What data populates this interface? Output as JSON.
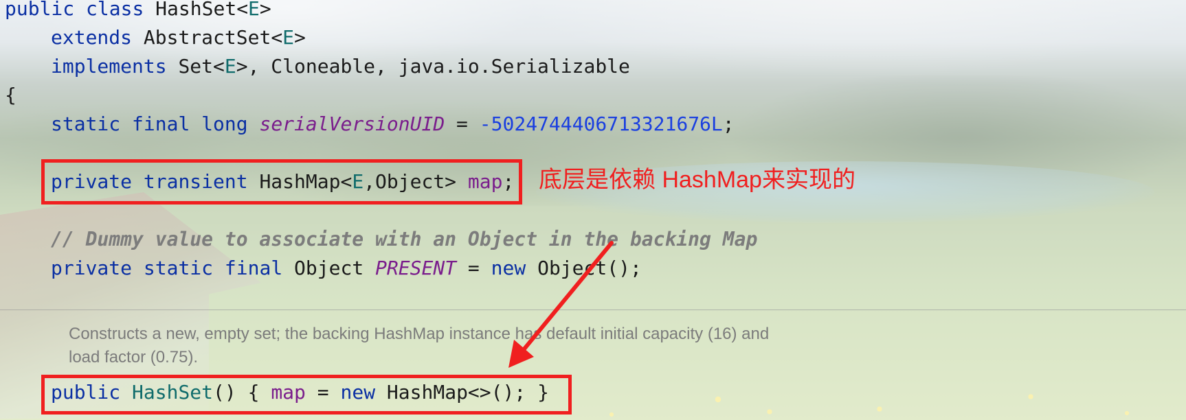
{
  "code": {
    "line1": {
      "kw_public": "public",
      "kw_class": "class",
      "class_name": "HashSet",
      "lt": "<",
      "type_param": "E",
      "gt": ">"
    },
    "line2": {
      "kw_extends": "extends",
      "super_name": "AbstractSet",
      "lt": "<",
      "type_param": "E",
      "gt": ">"
    },
    "line3": {
      "kw_implements": "implements",
      "iface_set": "Set",
      "lt": "<",
      "type_param": "E",
      "rest": ">, Cloneable, java.io.Serializable"
    },
    "line4": {
      "brace": "{"
    },
    "line5": {
      "kw_static": "static",
      "kw_final": "final",
      "kw_long": "long",
      "field": "serialVersionUID",
      "eq": " = ",
      "value": "-5024744406713321676L",
      "semi": ";"
    },
    "line6": {
      "kw_private": "private",
      "kw_transient": "transient",
      "type_pre": "HashMap<",
      "type_param": "E",
      "type_post": ",Object>",
      "field": "map",
      "semi": ";"
    },
    "line7": {
      "comment": "// Dummy value to associate with an Object in the backing Map"
    },
    "line8": {
      "kw_private": "private",
      "kw_static": "static",
      "kw_final": "final",
      "type": "Object",
      "field": "PRESENT",
      "eq": " = ",
      "kw_new": "new",
      "ctor": "Object();"
    },
    "doc": {
      "line1": "Constructs a new, empty set; the backing HashMap instance has default initial capacity (16) and",
      "line2": "load factor (0.75)."
    },
    "line9": {
      "kw_public": "public",
      "ctor_name": "HashSet",
      "open": "() { ",
      "field": "map",
      "eq": " = ",
      "kw_new": "new",
      "rest": "HashMap<>(); }"
    }
  },
  "annotation": {
    "text": "底层是依赖 HashMap来实现的",
    "color": "#f01f1f"
  },
  "colors": {
    "keyword": "#0a2fa3",
    "type_param": "#0f6b6b",
    "field": "#7a1d8c",
    "number": "#1a3fe0",
    "comment": "#7c7c7c",
    "highlight": "#f01f1f"
  }
}
